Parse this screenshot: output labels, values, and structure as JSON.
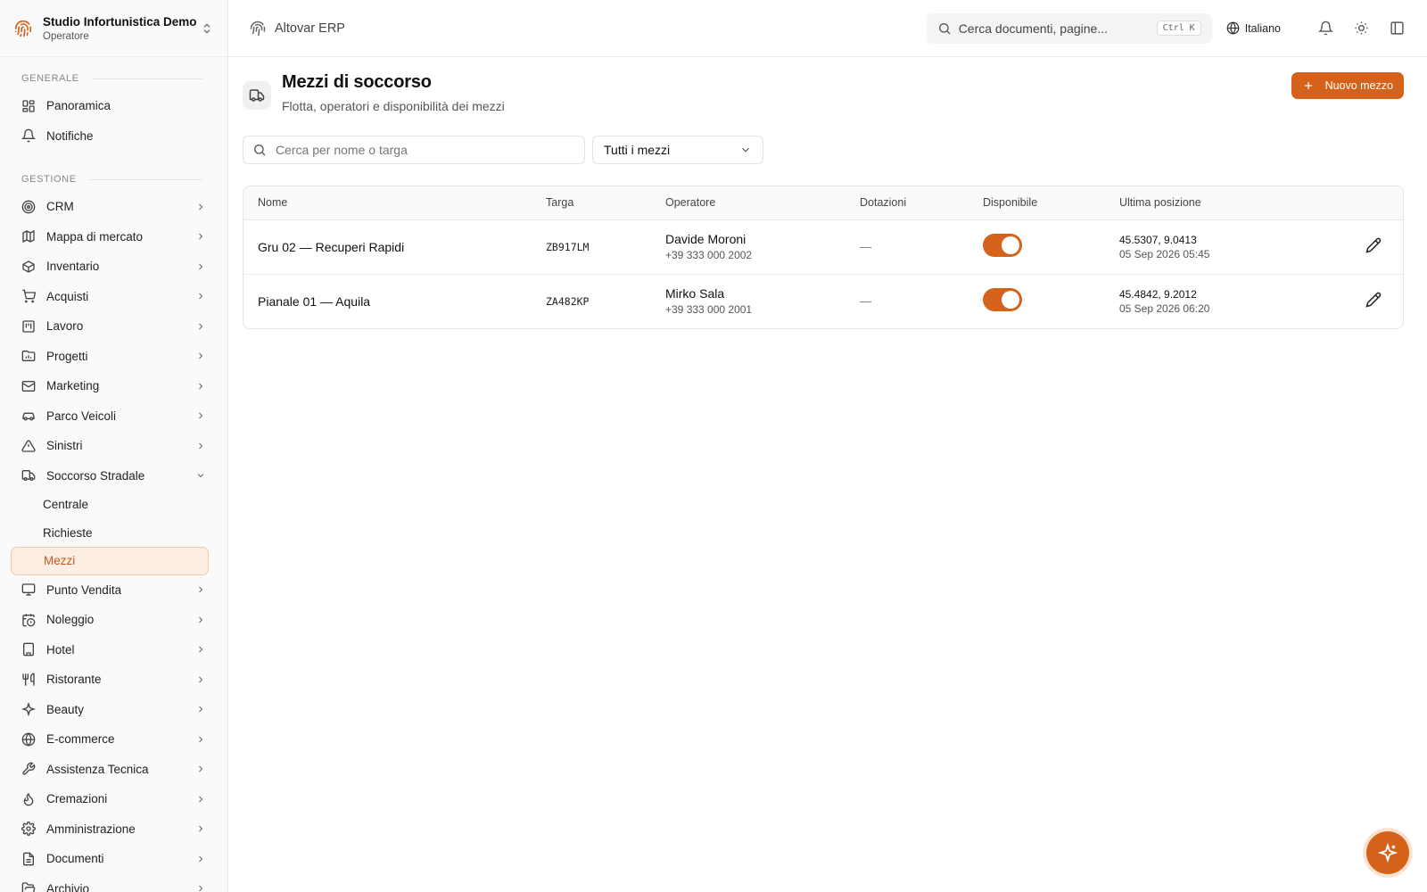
{
  "org": {
    "name": "Studio Infortunistica Demo",
    "role": "Operatore"
  },
  "header": {
    "app_name": "Altovar ERP",
    "search_placeholder": "Cerca documenti, pagine...",
    "search_shortcut": "Ctrl K",
    "language": "Italiano"
  },
  "sidebar": {
    "section_general": "GENERALE",
    "general_items": [
      {
        "label": "Panoramica",
        "icon": "dashboard-icon"
      },
      {
        "label": "Notifiche",
        "icon": "bell-icon"
      }
    ],
    "section_manage": "GESTIONE",
    "manage_items": [
      {
        "label": "CRM",
        "icon": "target-icon"
      },
      {
        "label": "Mappa di mercato",
        "icon": "map-icon"
      },
      {
        "label": "Inventario",
        "icon": "box-icon"
      },
      {
        "label": "Acquisti",
        "icon": "cart-icon"
      },
      {
        "label": "Lavoro",
        "icon": "kanban-icon"
      },
      {
        "label": "Progetti",
        "icon": "folder-chart-icon"
      },
      {
        "label": "Marketing",
        "icon": "mail-icon"
      },
      {
        "label": "Parco Veicoli",
        "icon": "car-icon"
      },
      {
        "label": "Sinistri",
        "icon": "warning-icon"
      },
      {
        "label": "Soccorso Stradale",
        "icon": "truck-icon"
      }
    ],
    "soccorso_sub": [
      "Centrale",
      "Richieste",
      "Mezzi"
    ],
    "after_items": [
      {
        "label": "Punto Vendita",
        "icon": "monitor-icon"
      },
      {
        "label": "Noleggio",
        "icon": "calendar-clock-icon"
      },
      {
        "label": "Hotel",
        "icon": "building-icon"
      },
      {
        "label": "Ristorante",
        "icon": "utensils-icon"
      },
      {
        "label": "Beauty",
        "icon": "sparkles-icon"
      },
      {
        "label": "E-commerce",
        "icon": "globe-icon"
      },
      {
        "label": "Assistenza Tecnica",
        "icon": "wrench-icon"
      },
      {
        "label": "Cremazioni",
        "icon": "flame-icon"
      },
      {
        "label": "Amministrazione",
        "icon": "gear-icon"
      },
      {
        "label": "Documenti",
        "icon": "file-icon"
      },
      {
        "label": "Archivio",
        "icon": "folder-open-icon"
      }
    ]
  },
  "page": {
    "title": "Mezzi di soccorso",
    "subtitle": "Flotta, operatori e disponibilità dei mezzi",
    "new_button": "Nuovo mezzo",
    "search_placeholder": "Cerca per nome o targa",
    "filter_value": "Tutti i mezzi"
  },
  "table": {
    "headers": [
      "Nome",
      "Targa",
      "Operatore",
      "Dotazioni",
      "Disponibile",
      "Ultima posizione"
    ],
    "rows": [
      {
        "name": "Gru 02 — Recuperi Rapidi",
        "plate": "ZB917LM",
        "operator": "Davide Moroni",
        "phone": "+39 333 000 2002",
        "equipment": "—",
        "available": true,
        "coords": "45.5307, 9.0413",
        "time": "05 Sep 2026 05:45"
      },
      {
        "name": "Pianale 01 — Aquila",
        "plate": "ZA482KP",
        "operator": "Mirko Sala",
        "phone": "+39 333 000 2001",
        "equipment": "—",
        "available": true,
        "coords": "45.4842, 9.2012",
        "time": "05 Sep 2026 06:20"
      }
    ]
  },
  "colors": {
    "accent": "#d4621a",
    "accent_soft": "#fdeee3"
  }
}
